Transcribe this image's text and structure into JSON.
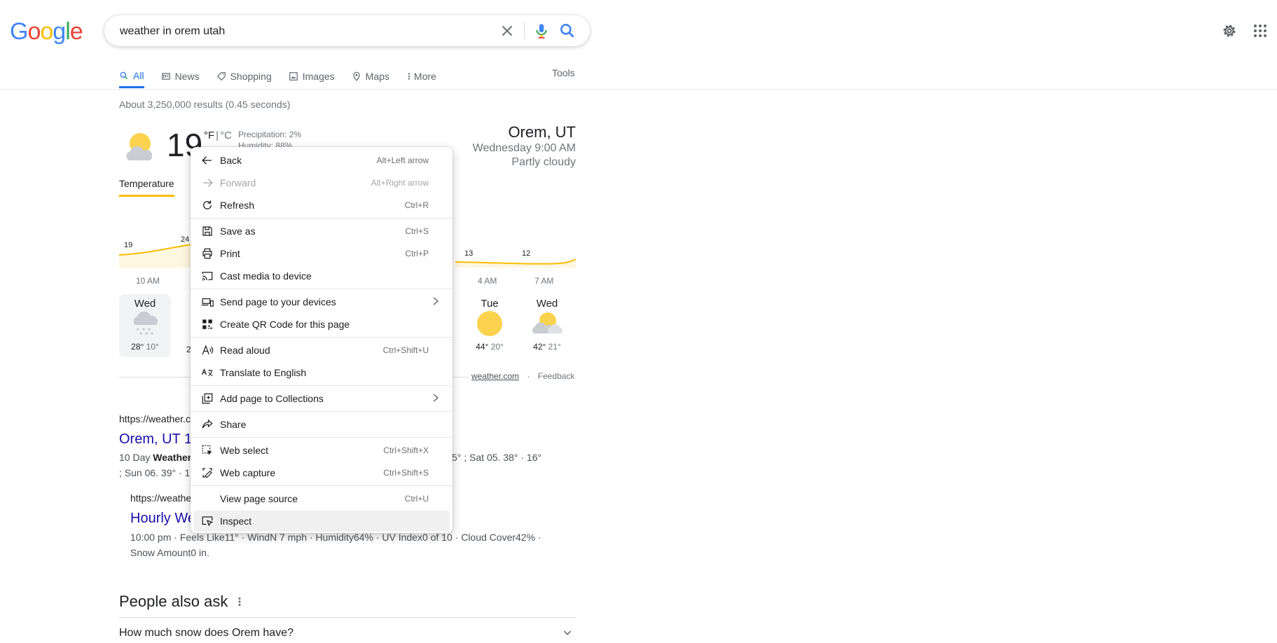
{
  "logo": [
    "G",
    "o",
    "o",
    "g",
    "l",
    "e"
  ],
  "search": {
    "query": "weather in orem utah"
  },
  "tabs": [
    {
      "label": "All",
      "icon": "search-icon"
    },
    {
      "label": "News",
      "icon": "news-icon"
    },
    {
      "label": "Shopping",
      "icon": "tag-icon"
    },
    {
      "label": "Images",
      "icon": "image-icon"
    },
    {
      "label": "Maps",
      "icon": "map-pin-icon"
    },
    {
      "label": "More",
      "icon": "more-vert-icon"
    }
  ],
  "tools_label": "Tools",
  "stats": "About 3,250,000 results (0.45 seconds)",
  "weather": {
    "temp": "19",
    "unit_f": "°F",
    "unit_c": "°C",
    "precipitation": "Precipitation: 2%",
    "humidity": "Humidity: 88%",
    "location": "Orem, UT",
    "time": "Wednesday 9:00 AM",
    "condition": "Partly cloudy",
    "tab_temperature": "Temperature",
    "chart_points": [
      "19",
      "24",
      "13",
      "12"
    ],
    "hours": [
      "10 AM",
      "4 AM",
      "7 AM"
    ],
    "days": [
      {
        "day": "Wed",
        "hi": "28°",
        "lo": "10°",
        "icon": "snow-icon"
      },
      {
        "day": "Tue",
        "hi": "44°",
        "lo": "20°",
        "icon": "sunny-icon"
      },
      {
        "day": "Wed",
        "hi": "42°",
        "lo": "21°",
        "icon": "partly-cloudy-icon"
      }
    ],
    "partial_hi": "2",
    "source": "weather.com",
    "feedback": "Feedback"
  },
  "result1": {
    "url": "https://weather.c",
    "title": "Orem, UT 10",
    "snippet_line1_pre": "10 Day ",
    "snippet_line1_bold": "Weather-",
    "snippet_line1_post": "5° ; Sat 05. 38° · 16°",
    "snippet_line2": "; Sun 06. 39° · 19"
  },
  "result2": {
    "url": "https://weathe",
    "title": "Hourly We",
    "snippet_line1": "10:00 pm · Feels Like11° · WindN 7 mph · Humidity64% · UV Index0 of 10 · Cloud Cover42% ·",
    "snippet_line2": "Snow Amount0 in."
  },
  "paa": {
    "title": "People also ask",
    "question": "How much snow does Orem have?"
  },
  "context_menu": [
    {
      "label": "Back",
      "shortcut": "Alt+Left arrow",
      "icon": "back-arrow-icon"
    },
    {
      "label": "Forward",
      "shortcut": "Alt+Right arrow",
      "icon": "forward-arrow-icon",
      "disabled": true
    },
    {
      "label": "Refresh",
      "shortcut": "Ctrl+R",
      "icon": "refresh-icon"
    },
    {
      "label": "Save as",
      "shortcut": "Ctrl+S",
      "icon": "save-icon"
    },
    {
      "label": "Print",
      "shortcut": "Ctrl+P",
      "icon": "print-icon"
    },
    {
      "label": "Cast media to device",
      "shortcut": "",
      "icon": "cast-icon"
    },
    {
      "label": "Send page to your devices",
      "shortcut": "",
      "icon": "devices-icon",
      "submenu": true
    },
    {
      "label": "Create QR Code for this page",
      "shortcut": "",
      "icon": "qr-code-icon"
    },
    {
      "label": "Read aloud",
      "shortcut": "Ctrl+Shift+U",
      "icon": "read-aloud-icon"
    },
    {
      "label": "Translate to English",
      "shortcut": "",
      "icon": "translate-icon"
    },
    {
      "label": "Add page to Collections",
      "shortcut": "",
      "icon": "collections-icon",
      "submenu": true
    },
    {
      "label": "Share",
      "shortcut": "",
      "icon": "share-icon"
    },
    {
      "label": "Web select",
      "shortcut": "Ctrl+Shift+X",
      "icon": "web-select-icon"
    },
    {
      "label": "Web capture",
      "shortcut": "Ctrl+Shift+S",
      "icon": "web-capture-icon"
    },
    {
      "label": "View page source",
      "shortcut": "Ctrl+U",
      "icon": ""
    },
    {
      "label": "Inspect",
      "shortcut": "",
      "icon": "inspect-icon",
      "highlighted": true
    }
  ],
  "colors": {
    "link": "#1a0dab",
    "accent": "#1a73e8",
    "sun": "#fbbc04"
  }
}
